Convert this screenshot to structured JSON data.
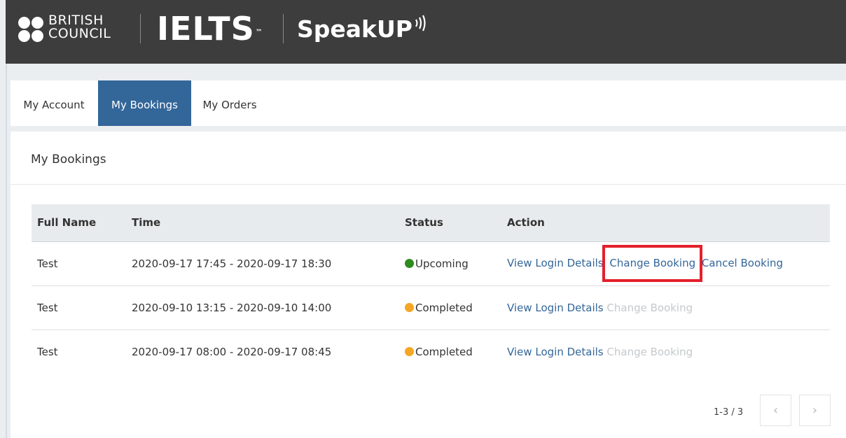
{
  "header": {
    "bc_line1": "BRITISH",
    "bc_line2": "COUNCIL",
    "ielts": "IELTS",
    "ielts_tm": "™",
    "speakup": "SpeakUP"
  },
  "tabs": [
    {
      "label": "My Account",
      "active": false
    },
    {
      "label": "My Bookings",
      "active": true
    },
    {
      "label": "My Orders",
      "active": false
    }
  ],
  "panel": {
    "title": "My Bookings"
  },
  "table": {
    "columns": [
      "Full Name",
      "Time",
      "Status",
      "Action"
    ],
    "rows": [
      {
        "name": "Test",
        "time": "2020-09-17 17:45 - 2020-09-17 18:30",
        "status": "Upcoming",
        "status_color": "#2e8b1e",
        "view": "View Login Details",
        "change": "Change Booking",
        "cancel": "Cancel Booking"
      },
      {
        "name": "Test",
        "time": "2020-09-10 13:15 - 2020-09-10 14:00",
        "status": "Completed",
        "status_color": "#f5a623",
        "view": "View Login Details",
        "change": "Change Booking"
      },
      {
        "name": "Test",
        "time": "2020-09-17 08:00 - 2020-09-17 08:45",
        "status": "Completed",
        "status_color": "#f5a623",
        "view": "View Login Details",
        "change": "Change Booking"
      }
    ]
  },
  "pagination": {
    "info": "1-3 / 3",
    "prev": "‹",
    "next": "›"
  },
  "colors": {
    "header_bg": "#3d3d3d",
    "active_tab": "#336699",
    "link": "#336699",
    "highlight": "#e3202b"
  }
}
